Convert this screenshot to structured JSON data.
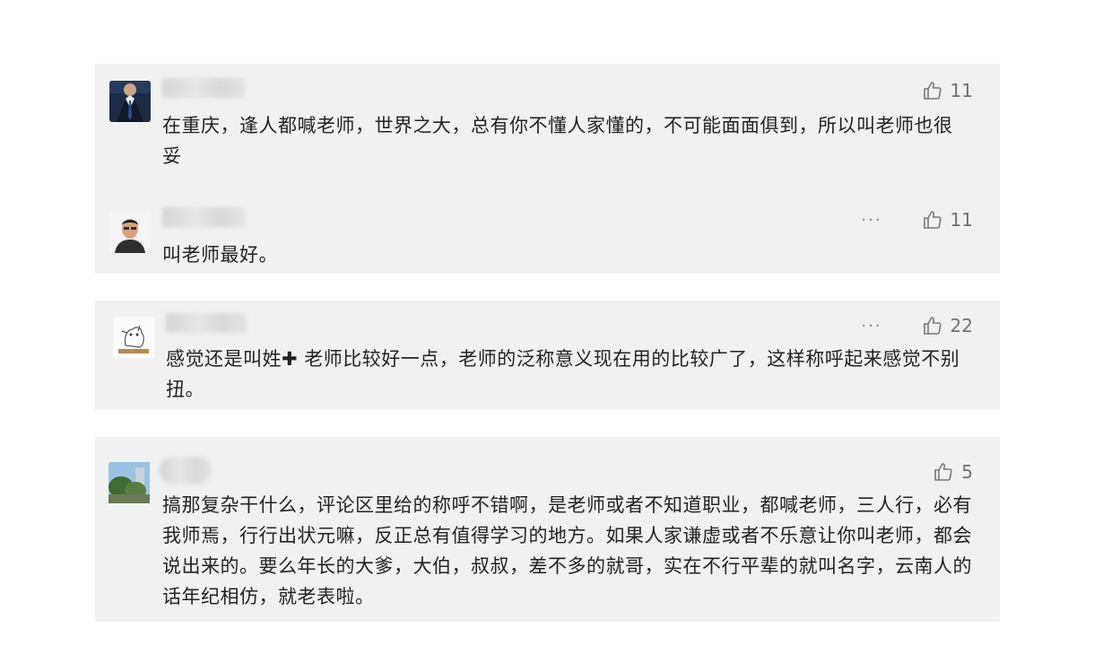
{
  "comments": [
    {
      "text": "在重庆，逢人都喊老师，世界之大，总有你不懂人家懂的，不可能面面俱到，所以叫老师也很妥",
      "likes": "11",
      "avatar": "suit-man-avatar",
      "reply": {
        "text": "叫老师最好。",
        "likes": "11",
        "more": "···",
        "avatar": "portrait-avatar"
      }
    },
    {
      "text": "感觉还是叫姓✚ 老师比较好一点，老师的泛称意义现在用的比较广了，这样称呼起来感觉不别扭。",
      "likes": "22",
      "more": "···",
      "avatar": "cartoon-avatar"
    },
    {
      "text": "搞那复杂干什么，评论区里给的称呼不错啊，是老师或者不知道职业，都喊老师，三人行，必有我师焉，行行出状元嘛，反正总有值得学习的地方。如果人家谦虚或者不乐意让你叫老师，都会说出来的。要么年长的大爹，大伯，叔叔，差不多的就哥，实在不行平辈的就叫名字，云南人的话年纪相仿，就老表啦。",
      "likes": "5",
      "avatar": "landscape-avatar"
    }
  ]
}
